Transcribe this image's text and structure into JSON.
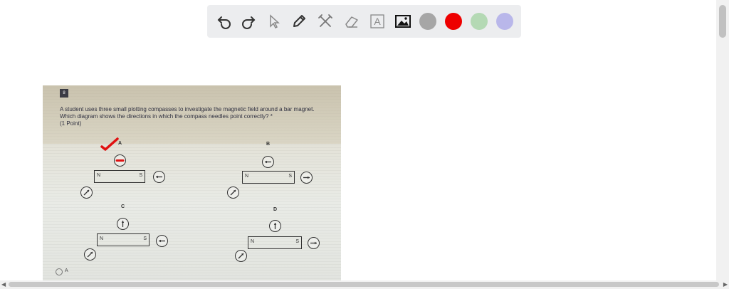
{
  "toolbar": {
    "tools": [
      {
        "name": "undo-icon"
      },
      {
        "name": "redo-icon"
      },
      {
        "name": "select-pointer-icon"
      },
      {
        "name": "pen-icon"
      },
      {
        "name": "tools-icon"
      },
      {
        "name": "eraser-icon"
      },
      {
        "name": "text-icon",
        "glyph": "A"
      },
      {
        "name": "image-icon"
      }
    ],
    "colors": [
      "#a6a6a6",
      "#ee0000",
      "#b4d9b4",
      "#b9b7ea"
    ]
  },
  "question": {
    "number": "8",
    "text": "A student uses three small plotting compasses to investigate the magnetic field around a bar magnet. Which diagram shows the directions in which the compass needles point correctly? *",
    "points": "(1 Point)",
    "diagrams": [
      "A",
      "B",
      "C",
      "D"
    ],
    "pole_north": "N",
    "pole_south": "S",
    "answer_option": "A"
  }
}
